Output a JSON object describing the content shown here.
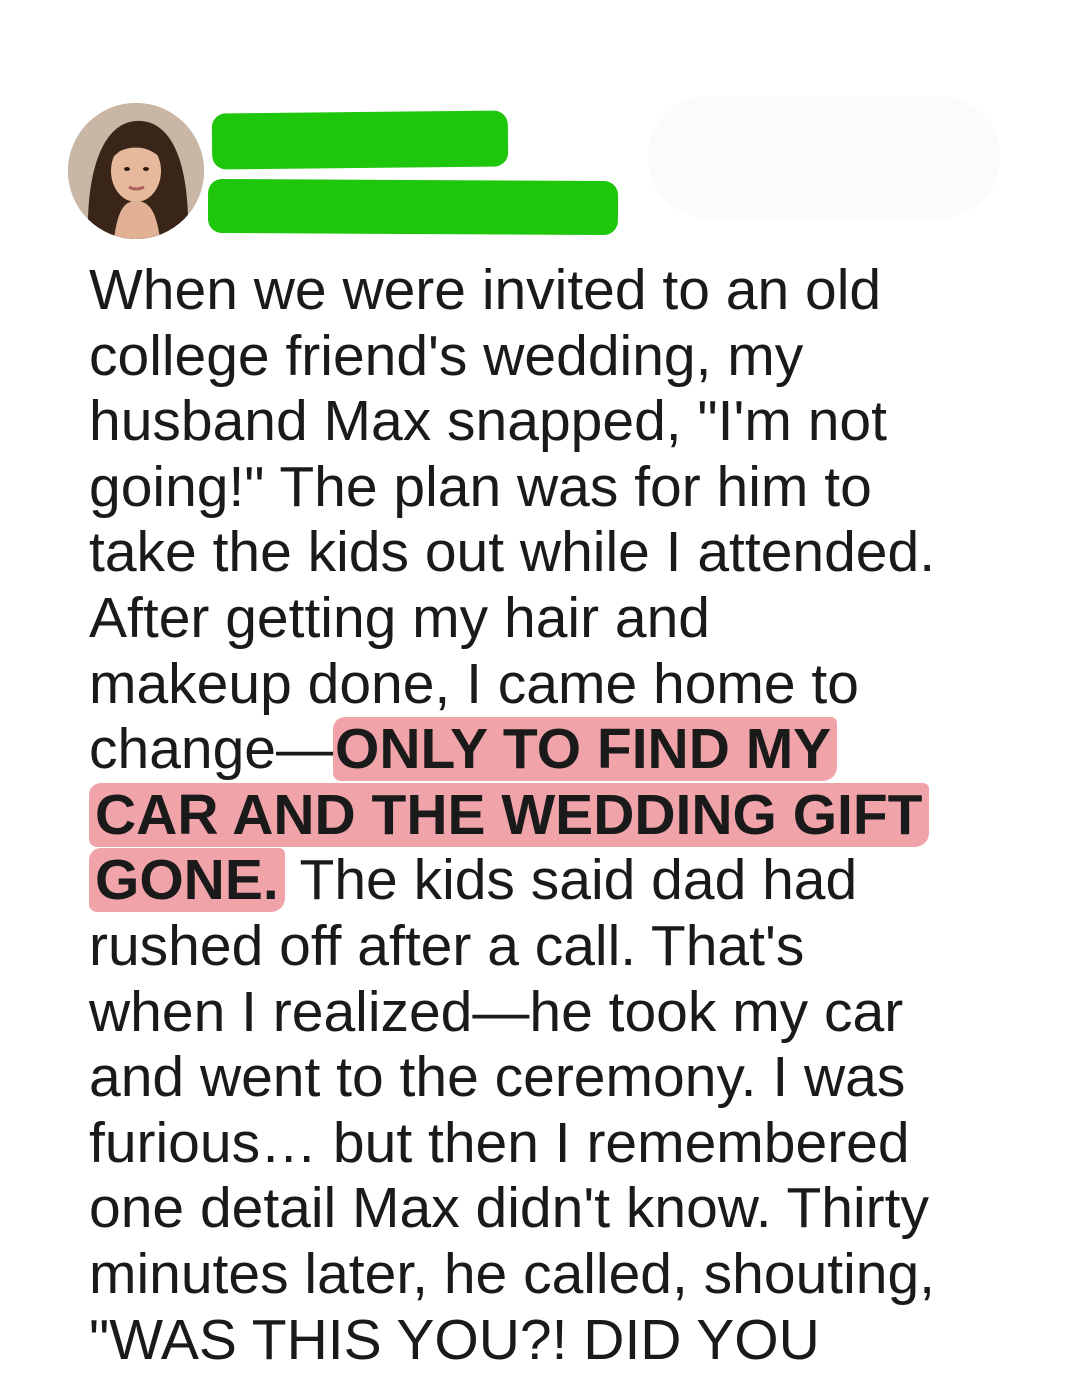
{
  "post": {
    "lines_before": [
      "When we were invited to an old",
      "college friend's wedding, my",
      "husband Max snapped, \"I'm not",
      "going!\" The plan was for him to",
      "take the kids out while I attended.",
      "After getting my hair and",
      "makeup done, I came home to"
    ],
    "change_prefix": "change—",
    "highlight_1": "ONLY TO FIND MY",
    "highlight_2": "CAR AND THE WEDDING GIFT",
    "highlight_3": "GONE.",
    "after_highlight": " The kids said dad had",
    "lines_after": [
      "rushed off after a call. That's",
      "when I realized—he took my car",
      "and went to the ceremony. I was",
      "furious… but then I remembered",
      "one detail Max didn't know. Thirty",
      "minutes later, he called, shouting,",
      "\"WAS THIS YOU?! DID YOU"
    ]
  },
  "colors": {
    "highlight": "#f0a3a8",
    "name_redaction": "#1ec60c",
    "text": "#1a1a1a"
  }
}
